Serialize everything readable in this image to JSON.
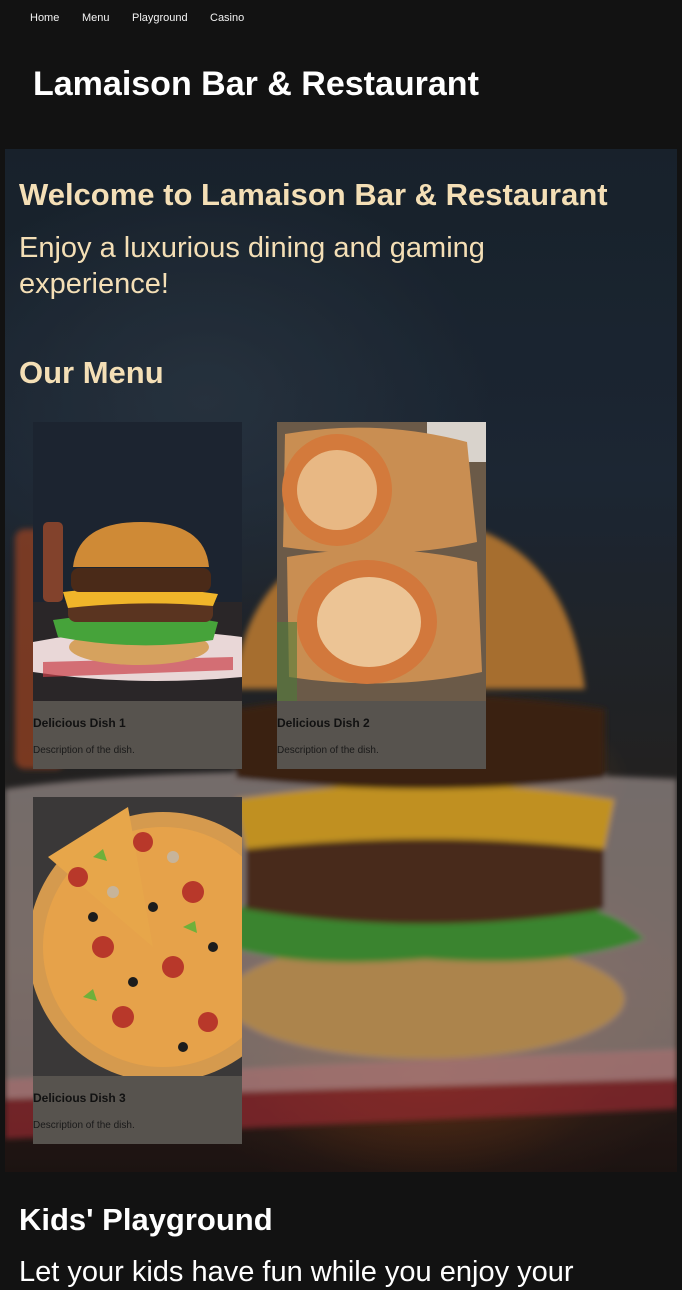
{
  "nav": {
    "items": [
      {
        "label": "Home"
      },
      {
        "label": "Menu"
      },
      {
        "label": "Playground"
      },
      {
        "label": "Casino"
      }
    ]
  },
  "header": {
    "title": "Lamaison Bar & Restaurant"
  },
  "hero": {
    "welcome": "Welcome to Lamaison Bar & Restaurant",
    "tagline": "Enjoy a luxurious dining and gaming experience!",
    "background_image": "burger-photo"
  },
  "menu": {
    "heading": "Our Menu",
    "dishes": [
      {
        "name": "Delicious Dish 1",
        "description": "Description of the dish.",
        "image": "burger-photo"
      },
      {
        "name": "Delicious Dish 2",
        "description": "Description of the dish.",
        "image": "wrap-photo"
      },
      {
        "name": "Delicious Dish 3",
        "description": "Description of the dish.",
        "image": "pizza-photo"
      }
    ]
  },
  "playground": {
    "heading": "Kids' Playground",
    "text": "Let your kids have fun while you enjoy your"
  },
  "colors": {
    "page_bg": "#121212",
    "accent_text": "#f4dfb6",
    "card_bg": "#57534e"
  }
}
